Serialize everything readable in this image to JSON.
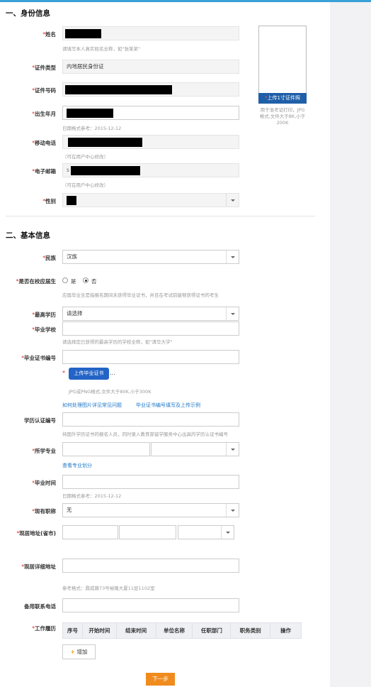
{
  "identity": {
    "title": "一、身份信息",
    "name": {
      "label": "姓名",
      "hint": "请填写本人真实姓名全称，如\"张某某\""
    },
    "id_type": {
      "label": "证件类型",
      "value": "内地居民身份证"
    },
    "id_number": {
      "label": "证件号码"
    },
    "birth": {
      "label": "出生年月",
      "hint": "日期格式参考：2015-12-12"
    },
    "mobile": {
      "label": "移动电话",
      "hint": "（可在用户中心修改）"
    },
    "email": {
      "label": "电子邮箱",
      "hint": "（可在用户中心修改）",
      "prefix": "s"
    },
    "gender": {
      "label": "性别"
    },
    "photo": {
      "button": "上传1寸证件照",
      "star": "*",
      "hint": "用于准考证打印，JPG格式,文件大于8K,小于200K"
    }
  },
  "basic": {
    "title": "二、基本信息",
    "ethnicity": {
      "label": "民族",
      "value": "汉族"
    },
    "current_grad": {
      "label": "是否在校应届生",
      "yes": "是",
      "no": "否",
      "selected": "否",
      "hint": "应届毕业生是指报名期间未获得毕业证书，并且在考试前能够获得证书的考生"
    },
    "education": {
      "label": "最高学历",
      "value": "请选择"
    },
    "school": {
      "label": "毕业学校",
      "hint": "请选择您已获得的最高学历的学校全称，如\"清华大学\""
    },
    "cert_no": {
      "label": "毕业证书编号"
    },
    "cert_upload": {
      "star": "*",
      "button": "上传毕业证书",
      "ellipsis": "...",
      "hint": "JPG或PNG格式,文件大于80K,小于300K",
      "link1": "如何处理图片详见常见问题",
      "link2": "毕业证书编号填写及上传示例"
    },
    "degree_cert": {
      "label": "学历认证编号",
      "hint": "持国外学历证书的报名人员，同时录入教育部留学服务中心出具的学历认证书编号"
    },
    "major": {
      "label": "所学专业",
      "link": "查看专业划分"
    },
    "grad_time": {
      "label": "毕业时间",
      "hint": "日期格式参考：2015-12-12"
    },
    "title_level": {
      "label": "现有职称",
      "value": "无"
    },
    "address": {
      "label": "现居地址(省市)"
    },
    "address_detail": {
      "label": "现居详细地址",
      "hint": "参考格式：鼎成路73号裕隆大厦11层1102室"
    },
    "backup_phone": {
      "label": "备用联系电话"
    },
    "work_history": {
      "label": "工作履历",
      "columns": [
        "序号",
        "开始时间",
        "结束时间",
        "单位名称",
        "任职部门",
        "职务类别",
        "操作"
      ],
      "add_label": "增加"
    }
  },
  "next_label": "下一步",
  "colors": {
    "accent": "#3aa0d8",
    "required": "#e02020",
    "primary_button": "#2364c6",
    "next_button": "#f08c1e",
    "link": "#1e78c8"
  }
}
